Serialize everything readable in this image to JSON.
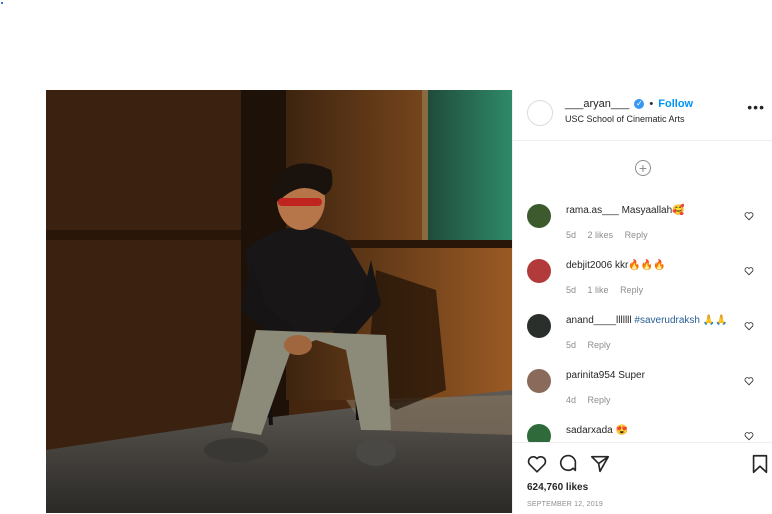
{
  "post": {
    "username": "___aryan___",
    "separator": "•",
    "follow_label": "Follow",
    "location": "USC School of Cinematic Arts",
    "more_label": "•••",
    "load_more_symbol": "+"
  },
  "comments": [
    {
      "user": "rama.as___",
      "text": "Masyaallah",
      "emoji": "🥰",
      "age": "5d",
      "likes": "2 likes",
      "reply": "Reply",
      "avatar_color": "#3c5a2e"
    },
    {
      "user": "debjit2006",
      "text": "kkr",
      "emoji": "🔥🔥🔥",
      "age": "5d",
      "likes": "1 like",
      "reply": "Reply",
      "avatar_color": "#b23a3a"
    },
    {
      "user": "anand____lllllll",
      "text": "#saverudraksh",
      "emoji": "🙏🙏",
      "age": "5d",
      "likes": "",
      "reply": "Reply",
      "avatar_color": "#2b2f2b"
    },
    {
      "user": "parinita954",
      "text": "Super",
      "emoji": "",
      "age": "4d",
      "likes": "",
      "reply": "Reply",
      "avatar_color": "#8a6b5b"
    },
    {
      "user": "sadarxada",
      "text": "",
      "emoji": "😍",
      "age": "",
      "likes": "",
      "reply": "",
      "avatar_color": "#2f6b3a"
    }
  ],
  "stats": {
    "likes": "624,760 likes",
    "date": "SEPTEMBER 12, 2019"
  },
  "colors": {
    "accent": "#0095f6",
    "border": "#efefef",
    "muted": "#8e8e8e"
  },
  "icons": [
    "heart-icon",
    "comment-icon",
    "share-icon",
    "bookmark-icon",
    "more-options-icon",
    "add-circle-icon",
    "verified-badge-icon"
  ]
}
